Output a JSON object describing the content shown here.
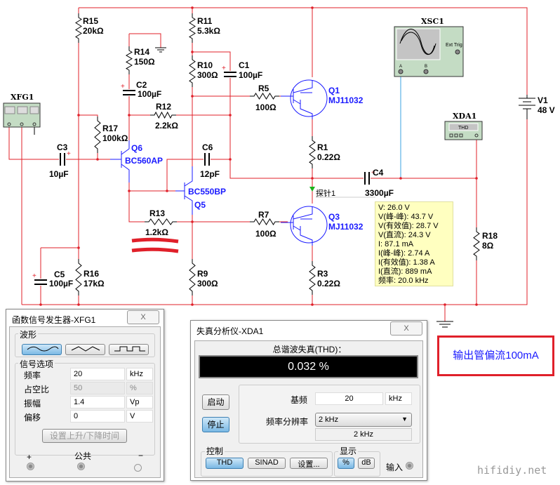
{
  "schematic": {
    "components": {
      "R15": {
        "ref": "R15",
        "value": "20kΩ"
      },
      "R11": {
        "ref": "R11",
        "value": "5.3kΩ"
      },
      "R14": {
        "ref": "R14",
        "value": "150Ω"
      },
      "R10": {
        "ref": "R10",
        "value": "300Ω"
      },
      "C1": {
        "ref": "C1",
        "value": "100µF"
      },
      "C2": {
        "ref": "C2",
        "value": "100µF"
      },
      "R5": {
        "ref": "R5",
        "value": "100Ω"
      },
      "R12": {
        "ref": "R12",
        "value": "2.2kΩ"
      },
      "R17": {
        "ref": "R17",
        "value": "100kΩ"
      },
      "C3": {
        "ref": "C3",
        "value": "10µF"
      },
      "C6": {
        "ref": "C6",
        "value": "12pF"
      },
      "R13": {
        "ref": "R13",
        "value": "1.2kΩ"
      },
      "R7": {
        "ref": "R7",
        "value": "100Ω"
      },
      "C5": {
        "ref": "C5",
        "value": "100µF"
      },
      "R16": {
        "ref": "R16",
        "value": "17kΩ"
      },
      "R9": {
        "ref": "R9",
        "value": "300Ω"
      },
      "R1": {
        "ref": "R1",
        "value": "0.22Ω"
      },
      "R3": {
        "ref": "R3",
        "value": "0.22Ω"
      },
      "C4": {
        "ref": "C4",
        "value": "3300µF"
      },
      "R18": {
        "ref": "R18",
        "value": "8Ω"
      },
      "V1": {
        "ref": "V1",
        "value": "48 V"
      },
      "Q1": {
        "ref": "Q1",
        "model": "MJ11032"
      },
      "Q3": {
        "ref": "Q3",
        "model": "MJ11032"
      },
      "Q6": {
        "ref": "Q6",
        "model": "BC560AP"
      },
      "Q5": {
        "ref": "Q5",
        "model": "BC550BP"
      }
    },
    "instruments": {
      "xfg": "XFG1",
      "xsc": "XSC1",
      "xsc_ext_trig": "Ext Trig",
      "xsc_a": "A",
      "xsc_b": "B",
      "xda": "XDA1",
      "xda_screen": "THD"
    },
    "probe": {
      "label": "探针1",
      "lines": [
        "V: 26.0 V",
        "V(峰-峰): 43.7 V",
        "V(有效值): 28.7 V",
        "V(直流): 24.3 V",
        "I: 87.1 mA",
        "I(峰-峰): 2.74 A",
        "I(有效值): 1.38 A",
        "I(直流): 889 mA",
        "频率: 20.0 kHz"
      ]
    },
    "colors": {
      "wire": "#e0202a",
      "component": "#1a1aff",
      "scope_wire": "#3aa0e0"
    }
  },
  "function_generator": {
    "title": "函数信号发生器-XFG1",
    "close": "X",
    "waveform_group": "波形",
    "waveforms": [
      "sine",
      "triangle",
      "square"
    ],
    "selected_waveform": "sine",
    "options_group": "信号选项",
    "fields": [
      {
        "label": "频率",
        "value": "20",
        "unit": "kHz",
        "disabled": false
      },
      {
        "label": "占空比",
        "value": "50",
        "unit": "%",
        "disabled": true
      },
      {
        "label": "振幅",
        "value": "1.4",
        "unit": "Vp",
        "disabled": false
      },
      {
        "label": "偏移",
        "value": "0",
        "unit": "V",
        "disabled": false
      }
    ],
    "rise_fall_button": "设置上升/下降时间",
    "terminals": {
      "plus": "+",
      "common": "公共",
      "minus": "−"
    }
  },
  "distortion_analyzer": {
    "title": "失真分析仪-XDA1",
    "close": "X",
    "thd_label": "总谐波失真(THD)：",
    "thd_value": "0.032 %",
    "start_button": "启动",
    "stop_button": "停止",
    "fundamental_label": "基频",
    "fundamental_value": "20",
    "fundamental_unit": "kHz",
    "resolution_label": "频率分辨率",
    "resolution_selected": "2 kHz",
    "resolution_readout": "2 kHz",
    "control_group": "控制",
    "thd_button": "THD",
    "sinad_button": "SINAD",
    "settings_button": "设置...",
    "display_group": "显示",
    "percent_button": "%",
    "db_button": "dB",
    "input_label": "输入"
  },
  "annotation": "输出管偏流100mA",
  "watermark": "hifidiy.net"
}
